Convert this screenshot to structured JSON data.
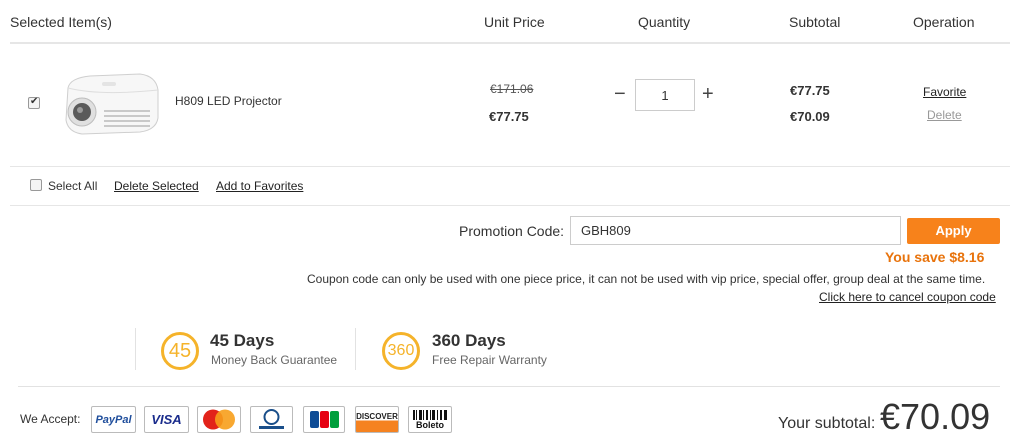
{
  "header": {
    "selected_items": "Selected Item(s)",
    "unit_price": "Unit Price",
    "quantity": "Quantity",
    "subtotal": "Subtotal",
    "operation": "Operation"
  },
  "product": {
    "name": "H809 LED Projector",
    "original_price": "€171.06",
    "unit_price": "€77.75",
    "quantity": "1",
    "subtotal_original": "€77.75",
    "subtotal_discounted": "€70.09",
    "favorite": "Favorite",
    "delete": "Delete",
    "checked": true
  },
  "qty_controls": {
    "minus": "−",
    "plus": "+"
  },
  "selection": {
    "select_all": "Select All",
    "delete_selected": "Delete Selected",
    "add_to_favorites": "Add to Favorites"
  },
  "promo": {
    "label": "Promotion Code:",
    "value": "GBH809",
    "apply": "Apply",
    "you_save": "You save $8.16",
    "notice": "Coupon code can only be used with one piece price, it can not be used with vip price, special offer, group deal at the same time.",
    "cancel_link": "Click here to cancel coupon code"
  },
  "guarantees": [
    {
      "badge": "45",
      "title": "45 Days",
      "subtitle": "Money Back Guarantee"
    },
    {
      "badge": "360",
      "title": "360 Days",
      "subtitle": "Free Repair Warranty"
    }
  ],
  "payment": {
    "we_accept": "We Accept:",
    "cards": [
      "PayPal",
      "VISA",
      "MasterCard",
      "Diners Club",
      "JCB",
      "DISCOVER",
      "Boleto"
    ]
  },
  "total": {
    "label": "Your subtotal:",
    "value": "€70.09"
  },
  "colors": {
    "accent_orange": "#f7821b",
    "save_text": "#e8730c",
    "badge_yellow": "#f5b32a"
  }
}
